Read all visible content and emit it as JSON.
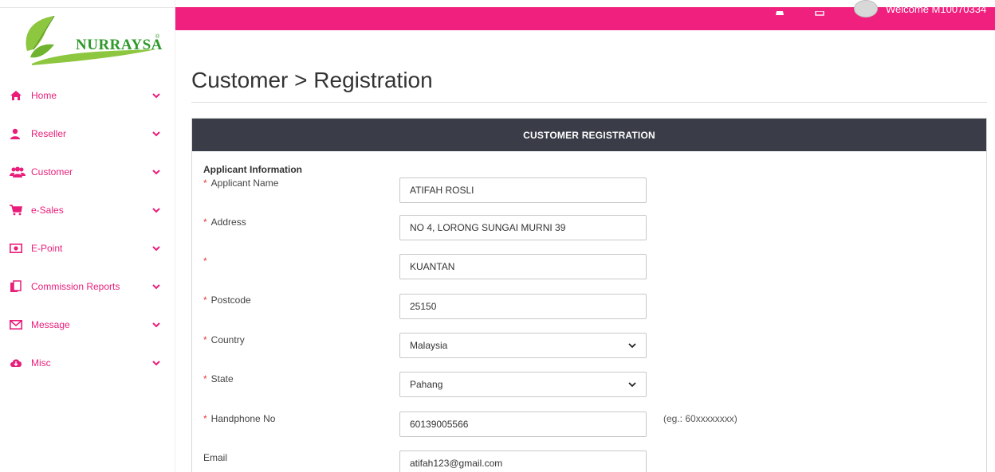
{
  "brand": {
    "name": "NURRAYSA",
    "reg": "®",
    "leaf_color": "#8dc63f",
    "text_color": "#2e9a2a"
  },
  "topbar": {
    "color": "#f0207e",
    "welcome": "Welcome M10070334"
  },
  "sidebar": {
    "items": [
      {
        "label": "Home",
        "icon": "home-icon"
      },
      {
        "label": "Reseller",
        "icon": "user-icon"
      },
      {
        "label": "Customer",
        "icon": "users-icon"
      },
      {
        "label": "e-Sales",
        "icon": "cart-icon"
      },
      {
        "label": "E-Point",
        "icon": "money-icon"
      },
      {
        "label": "Commission Reports",
        "icon": "files-icon"
      },
      {
        "label": "Message",
        "icon": "envelope-icon"
      },
      {
        "label": "Misc",
        "icon": "cloud-download-icon"
      }
    ]
  },
  "page": {
    "title": "Customer > Registration"
  },
  "panel": {
    "header": "CUSTOMER REGISTRATION",
    "section": "Applicant Information"
  },
  "form": {
    "applicant_name": {
      "label": "Applicant Name",
      "value": "ATIFAH ROSLI"
    },
    "address": {
      "label": "Address",
      "value1": "NO 4, LORONG SUNGAI MURNI 39",
      "value2": "KUANTAN"
    },
    "postcode": {
      "label": "Postcode",
      "value": "25150"
    },
    "country": {
      "label": "Country",
      "value": "Malaysia"
    },
    "state": {
      "label": "State",
      "value": "Pahang"
    },
    "handphone": {
      "label": "Handphone No",
      "value": "60139005566",
      "hint": "(eg.: 60xxxxxxxx)"
    },
    "email": {
      "label": "Email",
      "value": "atifah123@gmail.com"
    },
    "required_mark": "*"
  }
}
